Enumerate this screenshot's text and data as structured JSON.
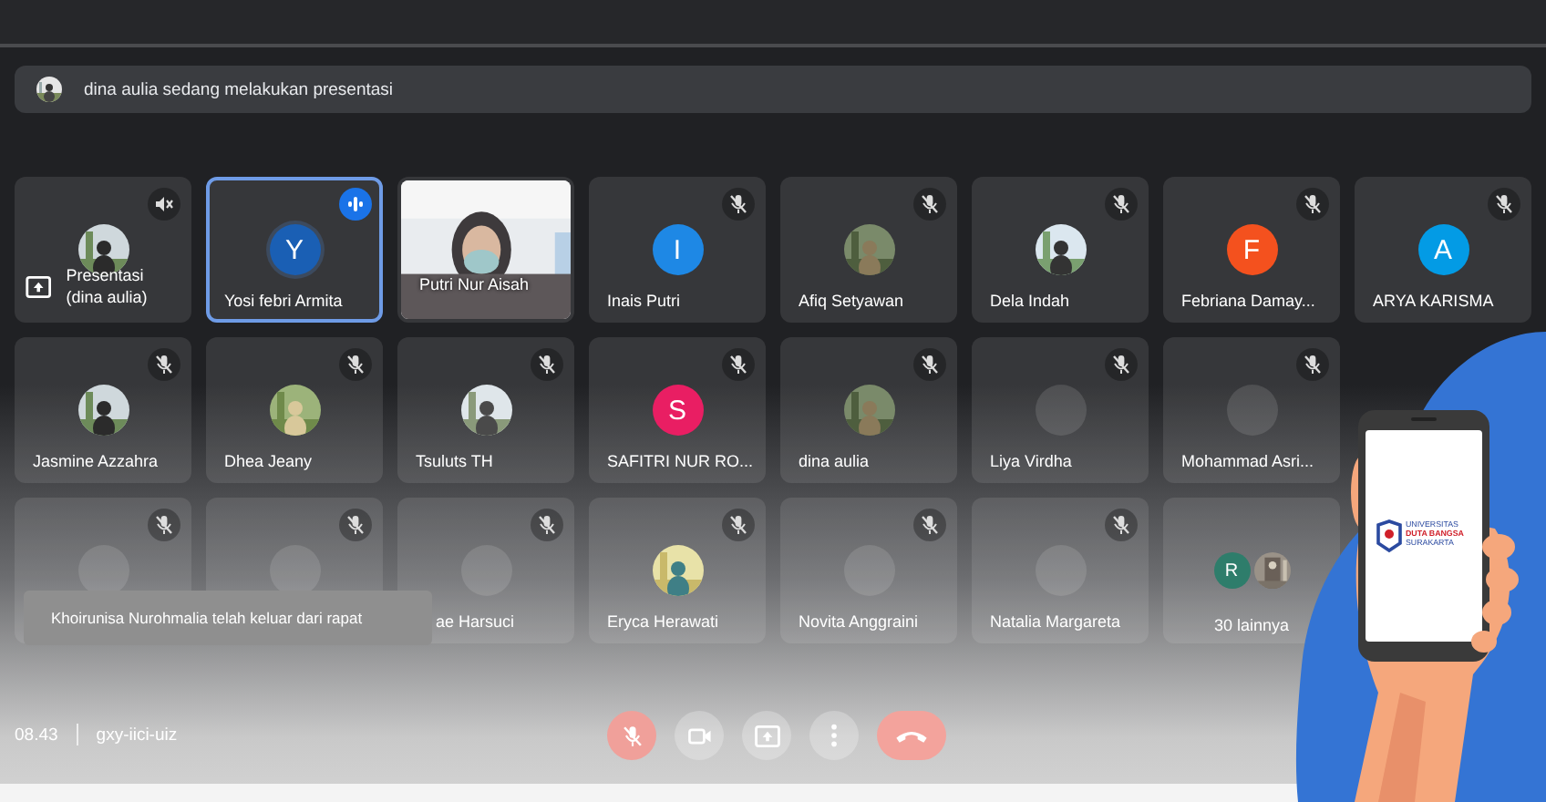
{
  "banner": {
    "text": "dina aulia sedang melakukan presentasi"
  },
  "rows": [
    [
      {
        "name": "Presentasi (dina aulia)",
        "avatar": {
          "kind": "presentation"
        },
        "mic": {
          "kind": "audio_off"
        },
        "active": false
      },
      {
        "name": "Yosi febri Armita",
        "avatar": {
          "kind": "letter",
          "letter": "Y",
          "color": "#1a5fb4"
        },
        "mic": {
          "kind": "speaking"
        },
        "active": true
      },
      {
        "name": "Putri Nur Aisah",
        "avatar": {
          "kind": "video"
        },
        "active": false
      },
      {
        "name": "Inais Putri",
        "avatar": {
          "kind": "letter",
          "letter": "I",
          "color": "#1e88e5"
        },
        "mic": {
          "kind": "muted"
        },
        "active": false
      },
      {
        "name": "Afiq Setyawan",
        "mic": {
          "kind": "muted"
        },
        "active": false
      },
      {
        "name": "Dela Indah",
        "mic": {
          "kind": "muted"
        },
        "active": false
      },
      {
        "name": "Febriana Damay...",
        "avatar": {
          "kind": "letter",
          "letter": "F",
          "color": "#f4511e"
        },
        "mic": {
          "kind": "muted"
        },
        "active": false
      },
      {
        "name": "ARYA KARISMA",
        "avatar": {
          "kind": "letter",
          "letter": "A",
          "color": "#039be5"
        },
        "mic": {
          "kind": "muted"
        },
        "active": false
      }
    ],
    [
      {
        "name": "Jasmine Azzahra",
        "mic": {
          "kind": "muted"
        },
        "active": false
      },
      {
        "name": "Dhea Jeany",
        "mic": {
          "kind": "muted"
        },
        "active": false
      },
      {
        "name": "Tsuluts TH",
        "mic": {
          "kind": "muted"
        },
        "active": false
      },
      {
        "name": "SAFITRI NUR RO...",
        "avatar": {
          "kind": "letter",
          "letter": "S",
          "color": "#e91e63"
        },
        "mic": {
          "kind": "muted"
        },
        "active": false
      },
      {
        "name": "dina aulia",
        "mic": {
          "kind": "muted"
        },
        "active": false
      },
      {
        "name": "Liya Virdha",
        "avatar": {
          "kind": "blank"
        },
        "mic": {
          "kind": "muted"
        },
        "active": false
      },
      {
        "name": "Mohammad Asri...",
        "avatar": {
          "kind": "blank"
        },
        "mic": {
          "kind": "muted"
        },
        "active": false
      }
    ],
    [
      {
        "avatar": {
          "kind": "blank"
        },
        "mic": {
          "kind": "muted"
        },
        "active": false
      },
      {
        "avatar": {
          "kind": "blank"
        },
        "mic": {
          "kind": "muted"
        },
        "active": false
      },
      {
        "name": "ae Harsuci",
        "name_covered": true,
        "avatar": {
          "kind": "blank"
        },
        "mic": {
          "kind": "muted"
        },
        "active": false
      },
      {
        "name": "Eryca Herawati",
        "mic": {
          "kind": "muted"
        },
        "active": false
      },
      {
        "name": "Novita Anggraini",
        "avatar": {
          "kind": "blank"
        },
        "mic": {
          "kind": "muted"
        },
        "active": false
      },
      {
        "name": "Natalia Margareta",
        "avatar": {
          "kind": "blank"
        },
        "mic": {
          "kind": "muted"
        },
        "active": false
      },
      {
        "name": "30 lainnya",
        "avatar": {
          "kind": "others",
          "letter": "R",
          "color": "#2e7d6b"
        },
        "active": false
      }
    ]
  ],
  "toast": {
    "text": "Khoirunisa Nurohmalia telah keluar dari rapat"
  },
  "footer": {
    "time": "08.43",
    "code": "gxy-iici-uiz"
  },
  "controls": [
    {
      "kind": "mic",
      "on": false
    },
    {
      "kind": "camera",
      "on": true
    },
    {
      "kind": "present"
    },
    {
      "kind": "more"
    },
    {
      "kind": "hangup"
    }
  ],
  "phone_logo": [
    "UNIVERSITAS",
    "DUTA BANGSA",
    "SURAKARTA"
  ]
}
